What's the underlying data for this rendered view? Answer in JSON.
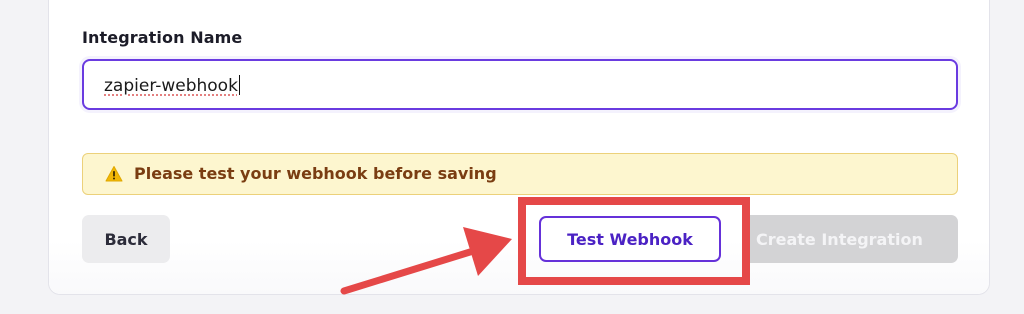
{
  "form": {
    "integration_name_label": "Integration Name",
    "integration_name_value": "zapier-webhook"
  },
  "warning": {
    "icon": "warning-triangle-icon",
    "message": "Please test your webhook before saving"
  },
  "actions": {
    "back_label": "Back",
    "test_label": "Test Webhook",
    "create_label": "Create Integration"
  },
  "colors": {
    "accent": "#6531d9",
    "warning_bg": "#fdf6cf",
    "warning_text": "#7a3d12",
    "annotation_red": "#e54848",
    "disabled_button": "#d3d3d5"
  }
}
